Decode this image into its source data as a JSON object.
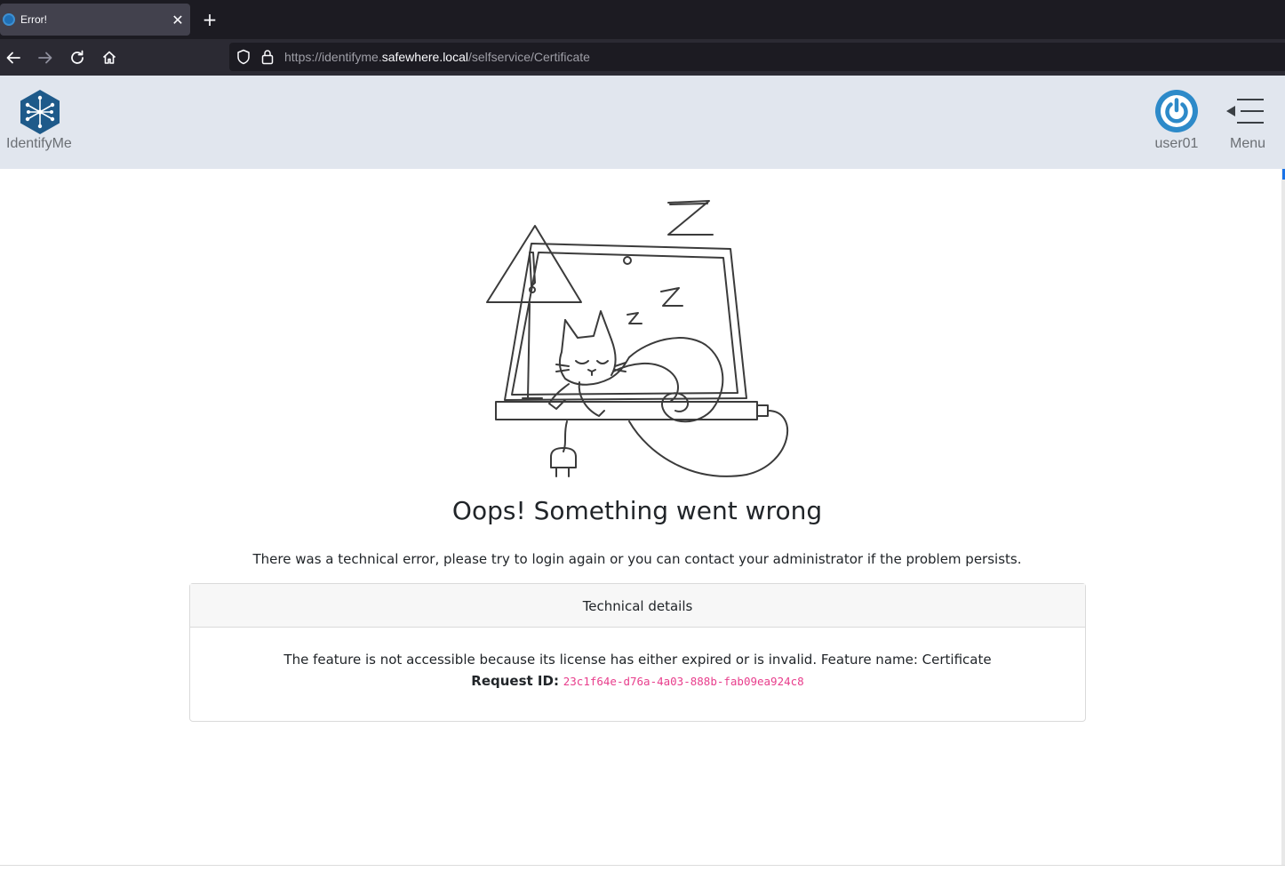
{
  "browser": {
    "tab_title": "Error!",
    "tab_close": "✕",
    "new_tab": "+",
    "url": {
      "prefix": "https://identifyme.",
      "host": "safewhere.local",
      "path": "/selfservice/Certificate"
    }
  },
  "header": {
    "brand": "IdentifyMe",
    "user": "user01",
    "menu": "Menu",
    "brand_color": "#1e5a8a",
    "power_color": "#2d8ac9"
  },
  "error": {
    "title": "Oops! Something went wrong",
    "message": "There was a technical error, please try to login again or you can contact your administrator if the problem persists.",
    "details_header": "Technical details",
    "details_text": "The feature is not accessible because its license has either expired or is invalid. Feature name: Certificate",
    "request_label": "Request ID:",
    "request_id": "23c1f64e-d76a-4a03-888b-fab09ea924c8"
  }
}
